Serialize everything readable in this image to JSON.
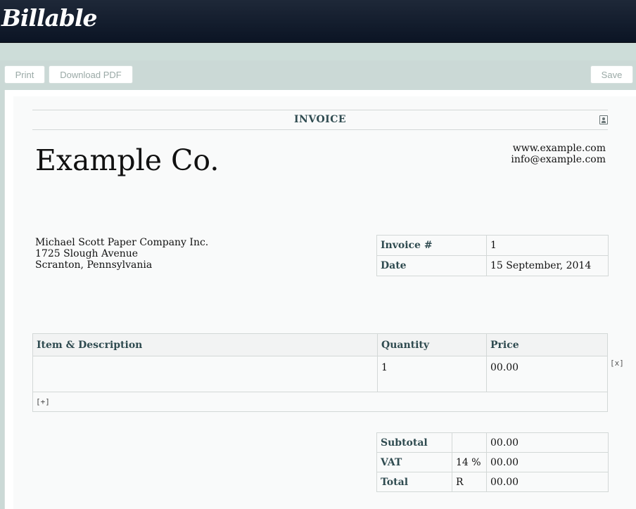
{
  "app": {
    "logo": "Billable"
  },
  "toolbar": {
    "print_label": "Print",
    "pdf_label": "Download PDF",
    "save_label": "Save"
  },
  "invoice": {
    "title": "INVOICE",
    "company_name": "Example Co.",
    "website": "www.example.com",
    "email": "info@example.com",
    "client": {
      "name": "Michael Scott Paper Company Inc.",
      "street": "1725 Slough Avenue",
      "city": "Scranton, Pennsylvania"
    },
    "meta": {
      "number_label": "Invoice #",
      "number_value": "1",
      "date_label": "Date",
      "date_value": "15 September, 2014"
    },
    "items": {
      "headers": [
        "Item & Description",
        "Quantity",
        "Price"
      ],
      "rows": [
        {
          "description": "",
          "quantity": "1",
          "price": "00.00"
        }
      ],
      "add_label": "[+]",
      "remove_label": "[x]"
    },
    "totals": {
      "subtotal_label": "Subtotal",
      "subtotal_value": "00.00",
      "vat_label": "VAT",
      "vat_rate": "14 %",
      "vat_value": "00.00",
      "total_label": "Total",
      "currency": "R",
      "total_value": "00.00"
    }
  },
  "icons": {
    "contact": "contact-card-icon"
  }
}
